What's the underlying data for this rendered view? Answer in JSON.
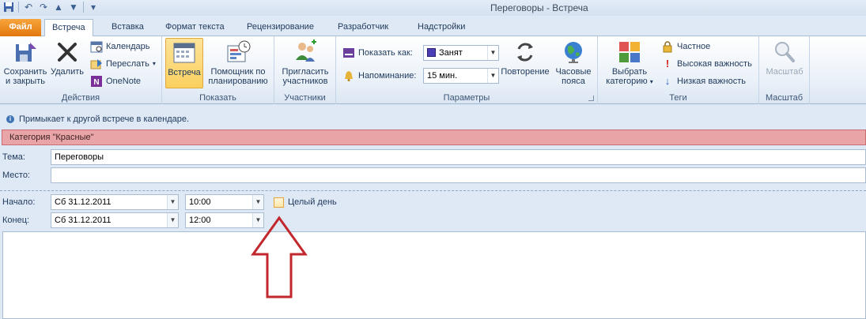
{
  "window": {
    "title": "Переговоры - Встреча"
  },
  "tabs": {
    "file": "Файл",
    "items": [
      "Встреча",
      "Вставка",
      "Формат текста",
      "Рецензирование",
      "Разработчик",
      "Надстройки"
    ]
  },
  "ribbon": {
    "actions": {
      "label": "Действия",
      "save_close": [
        "Сохранить",
        "и закрыть"
      ],
      "delete": "Удалить",
      "calendar": "Календарь",
      "forward": "Переслать",
      "onenote": "OneNote"
    },
    "show": {
      "label": "Показать",
      "appointment": "Встреча",
      "scheduling": [
        "Помощник по",
        "планированию"
      ]
    },
    "attendees": {
      "label": "Участники",
      "invite": [
        "Пригласить",
        "участников"
      ]
    },
    "options": {
      "label": "Параметры",
      "show_as_label": "Показать как:",
      "show_as_value": "Занят",
      "reminder_label": "Напоминание:",
      "reminder_value": "15 мин.",
      "recurrence": "Повторение",
      "timezones": [
        "Часовые",
        "пояса"
      ]
    },
    "tags": {
      "label": "Теги",
      "categorize": [
        "Выбрать",
        "категорию"
      ],
      "private": "Частное",
      "high": "Высокая важность",
      "low": "Низкая важность"
    },
    "zoom": {
      "label": "Масштаб",
      "button": "Масштаб"
    }
  },
  "info": {
    "message": "Примыкает к другой встрече в календаре.",
    "category": "Категория \"Красные\""
  },
  "form": {
    "subject_label": "Тема:",
    "subject_value": "Переговоры",
    "location_label": "Место:",
    "location_value": "",
    "start_label": "Начало:",
    "start_date": "Сб 31.12.2011",
    "start_time": "10:00",
    "end_label": "Конец:",
    "end_date": "Сб 31.12.2011",
    "end_time": "12:00",
    "all_day": "Целый день"
  },
  "colors": {
    "category": "#e8a4a6",
    "file_tab": "#e2780c",
    "arrow": "#c1272d",
    "busy": "#4a3fb5"
  }
}
